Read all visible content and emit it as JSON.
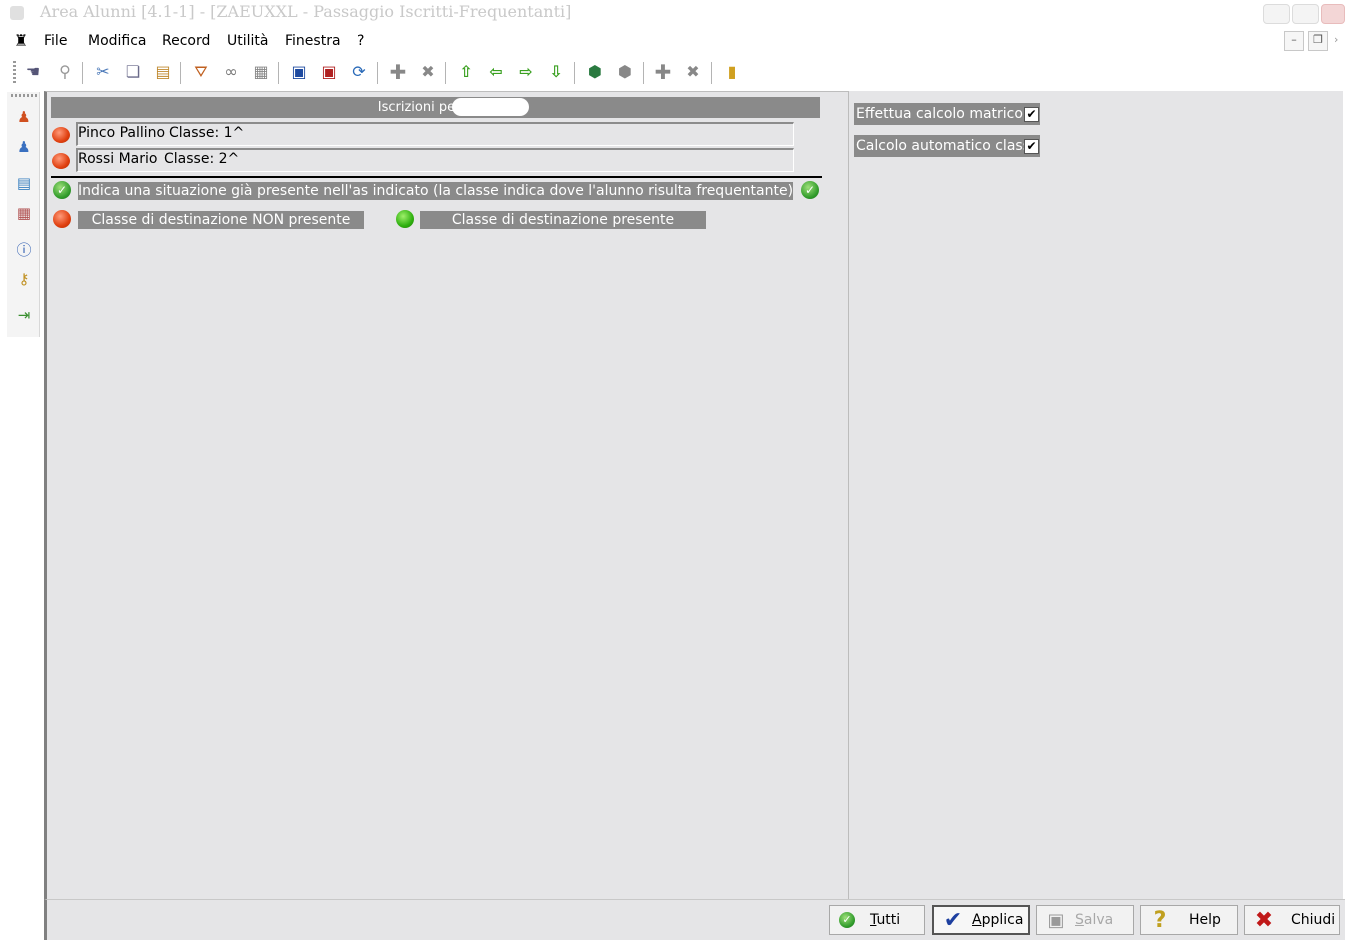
{
  "window": {
    "title": "Area Alunni [4.1-1] - [ZAEUXXL - Passaggio Iscritti-Frequentanti]"
  },
  "menu": {
    "items": [
      "File",
      "Modifica",
      "Record",
      "Utilità",
      "Finestra",
      "?"
    ]
  },
  "toolbar": {
    "icons": [
      "navigator-icon",
      "search-icon",
      "cut-icon",
      "copy-icon",
      "paste-icon",
      "filter-icon",
      "link-icon",
      "grid-icon",
      "save-icon",
      "save-close-icon",
      "refresh-icon",
      "add-icon",
      "delete-icon",
      "up-arrow-icon",
      "left-arrow-icon",
      "right-arrow-icon",
      "down-arrow-icon",
      "import-icon",
      "export-icon",
      "add-record-icon",
      "delete-record-icon",
      "exit-icon"
    ]
  },
  "sidebar": {
    "icons": [
      "student-icon",
      "teacher-icon",
      "calculator-icon",
      "calendar-icon",
      "help-icon",
      "keys-icon",
      "exit-door-icon"
    ]
  },
  "enrollments": {
    "header": "Iscrizioni per l'AS:",
    "rows": [
      {
        "name": "Pinco Pallino",
        "class_label": "Classe: 1^"
      },
      {
        "name": "Rossi Mario",
        "class_label": "Classe: 2^"
      }
    ]
  },
  "legend": {
    "present_situation": "Indica una situazione già presente nell'as indicato (la classe indica dove l'alunno risulta frequentante)",
    "dest_not_present": "Classe di destinazione NON presente",
    "dest_present": "Classe di destinazione presente"
  },
  "options": {
    "matricola": {
      "label": "Effettua calcolo matricola",
      "checked": true,
      "mark": "✔"
    },
    "auto_class": {
      "label": "Calcolo automatico classe",
      "checked": true,
      "mark": "✔"
    }
  },
  "buttons": {
    "all": "Tutti",
    "apply": "Applica",
    "save": "Salva",
    "help": "Help",
    "close": "Chiudi"
  },
  "colors": {
    "panel_bg": "#e5e5e7",
    "label_bg": "#8a8a8a",
    "status_red": "#e04010",
    "status_green": "#2fb010"
  }
}
